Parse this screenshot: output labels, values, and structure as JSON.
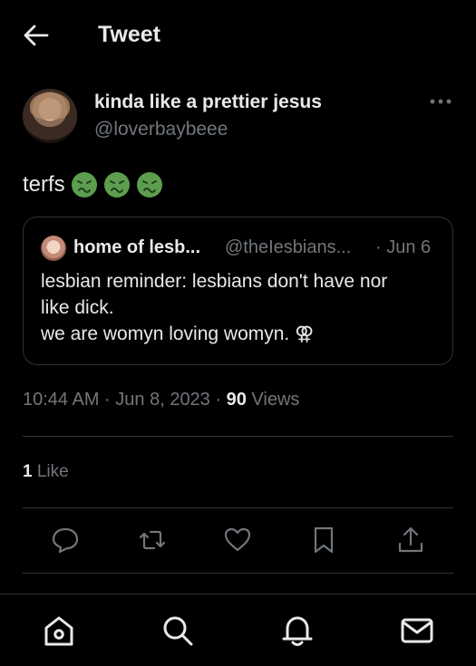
{
  "header": {
    "title": "Tweet",
    "back_icon": "arrow-left-icon"
  },
  "author": {
    "display_name": "kinda like a prettier jesus",
    "handle": "@loverbaybeee",
    "more_icon": "more-icon"
  },
  "tweet": {
    "text": "terfs",
    "emojis": [
      "nauseated-face-emoji",
      "nauseated-face-emoji",
      "nauseated-face-emoji"
    ]
  },
  "quote": {
    "display_name": "home of lesb...",
    "handle": "@theIesbians...",
    "date": "· Jun 6",
    "lines": [
      "lesbian reminder: lesbians don't have nor",
      "like dick.",
      "we are womyn loving womyn. ⚢"
    ]
  },
  "meta": {
    "time": "10:44 AM · Jun 8, 2023 · ",
    "views_count": "90",
    "views_label": " Views"
  },
  "stats": {
    "likes_count": "1",
    "likes_label": " Like"
  },
  "actions": [
    "reply-icon",
    "retweet-icon",
    "like-icon",
    "bookmark-icon",
    "share-icon"
  ],
  "nav": [
    "home-icon",
    "search-icon",
    "notifications-icon",
    "messages-icon"
  ],
  "colors": {
    "background": "#000000",
    "text": "#e7e9ea",
    "muted": "#71767b",
    "border": "#2f3336",
    "emoji": "#5c9e4e"
  }
}
